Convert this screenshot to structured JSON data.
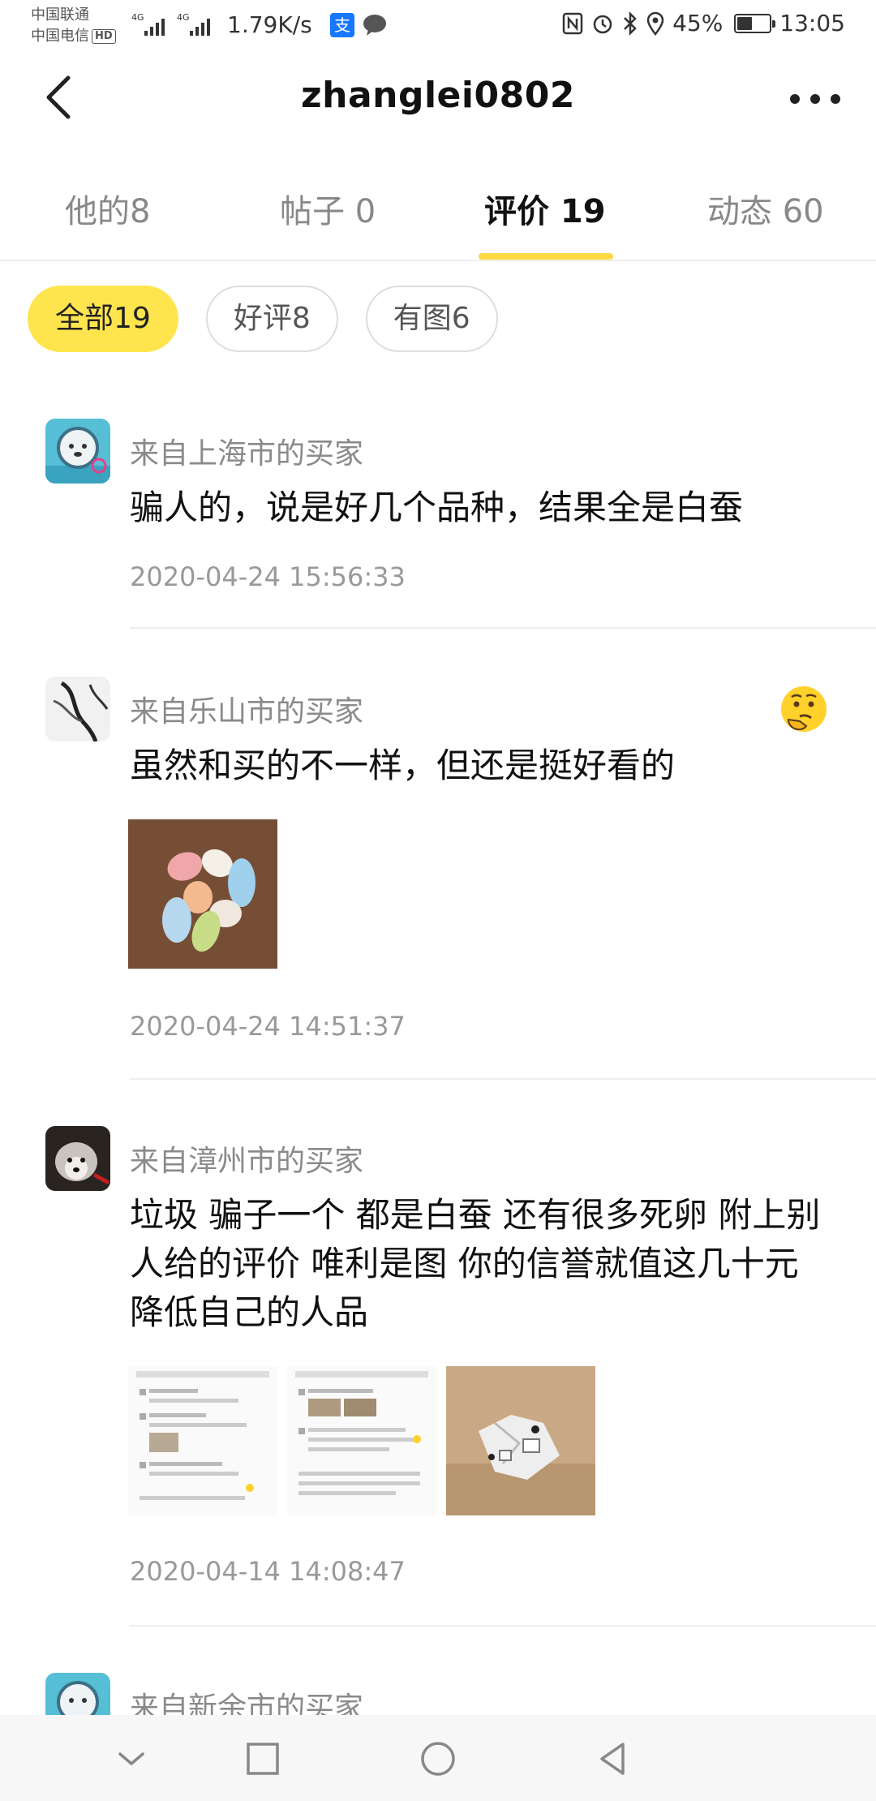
{
  "status_bar": {
    "carrier1": "中国联通",
    "carrier2": "中国电信",
    "hd": "HD",
    "signal_type": "4G",
    "net_speed": "1.79K/s",
    "alipay_glyph": "支",
    "battery": "45%",
    "time": "13:05"
  },
  "header": {
    "title": "zhanglei0802",
    "back_icon": "chevron-left-icon",
    "more_icon": "more-dots-icon"
  },
  "tabs": [
    {
      "label": "他的8",
      "active": false
    },
    {
      "label": "帖子 0",
      "active": false
    },
    {
      "label": "评价 19",
      "active": true
    },
    {
      "label": "动态 60",
      "active": false
    }
  ],
  "filters": [
    {
      "label": "全部19",
      "active": true
    },
    {
      "label": "好评8",
      "active": false
    },
    {
      "label": "有图6",
      "active": false
    }
  ],
  "reviews": [
    {
      "from": "来自上海市的买家",
      "text": "骗人的，说是好几个品种，结果全是白蚕",
      "time": "2020-04-24 15:56:33"
    },
    {
      "from": "来自乐山市的买家",
      "text": "虽然和买的不一样，但还是挺好看的",
      "time": "2020-04-24 14:51:37",
      "emoji": "thinking-face-icon"
    },
    {
      "from": "来自漳州市的买家",
      "text": "垃圾 骗子一个 都是白蚕 还有很多死卵 附上别人给的评价 唯利是图 你的信誉就值这几十元 降低自己的人品",
      "time": "2020-04-14 14:08:47"
    },
    {
      "from": "来自新余市的买家"
    }
  ],
  "colors": {
    "accent": "#ffda44",
    "chip_active": "#ffe54d"
  }
}
